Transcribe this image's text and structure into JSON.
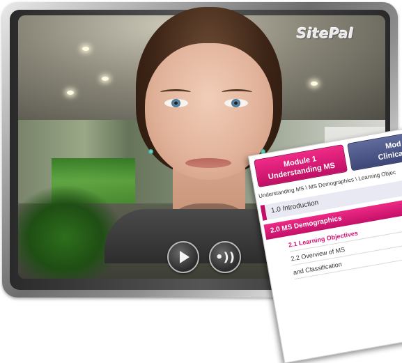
{
  "player": {
    "brand_logo": "SitePal",
    "controls": {
      "play_icon": "play-icon",
      "volume_icon": "volume-icon"
    }
  },
  "course": {
    "tabs": [
      {
        "line1": "Module 1",
        "line2": "Understanding MS"
      },
      {
        "line1": "Mod",
        "line2": "Clinical F"
      }
    ],
    "breadcrumb": "Understanding MS \\ MS Demographics \\ Learning Objec",
    "sections": [
      {
        "label": "1.0 Introduction",
        "chevron": "»"
      },
      {
        "label": "2.0 MS Demographics",
        "chevron": "»"
      }
    ],
    "subsections": [
      "2.1 Learning Objectives",
      "2.2 Overview of MS",
      "and Classification"
    ]
  },
  "colors": {
    "accent_pink": "#c10f66",
    "accent_blue": "#3e4878"
  }
}
